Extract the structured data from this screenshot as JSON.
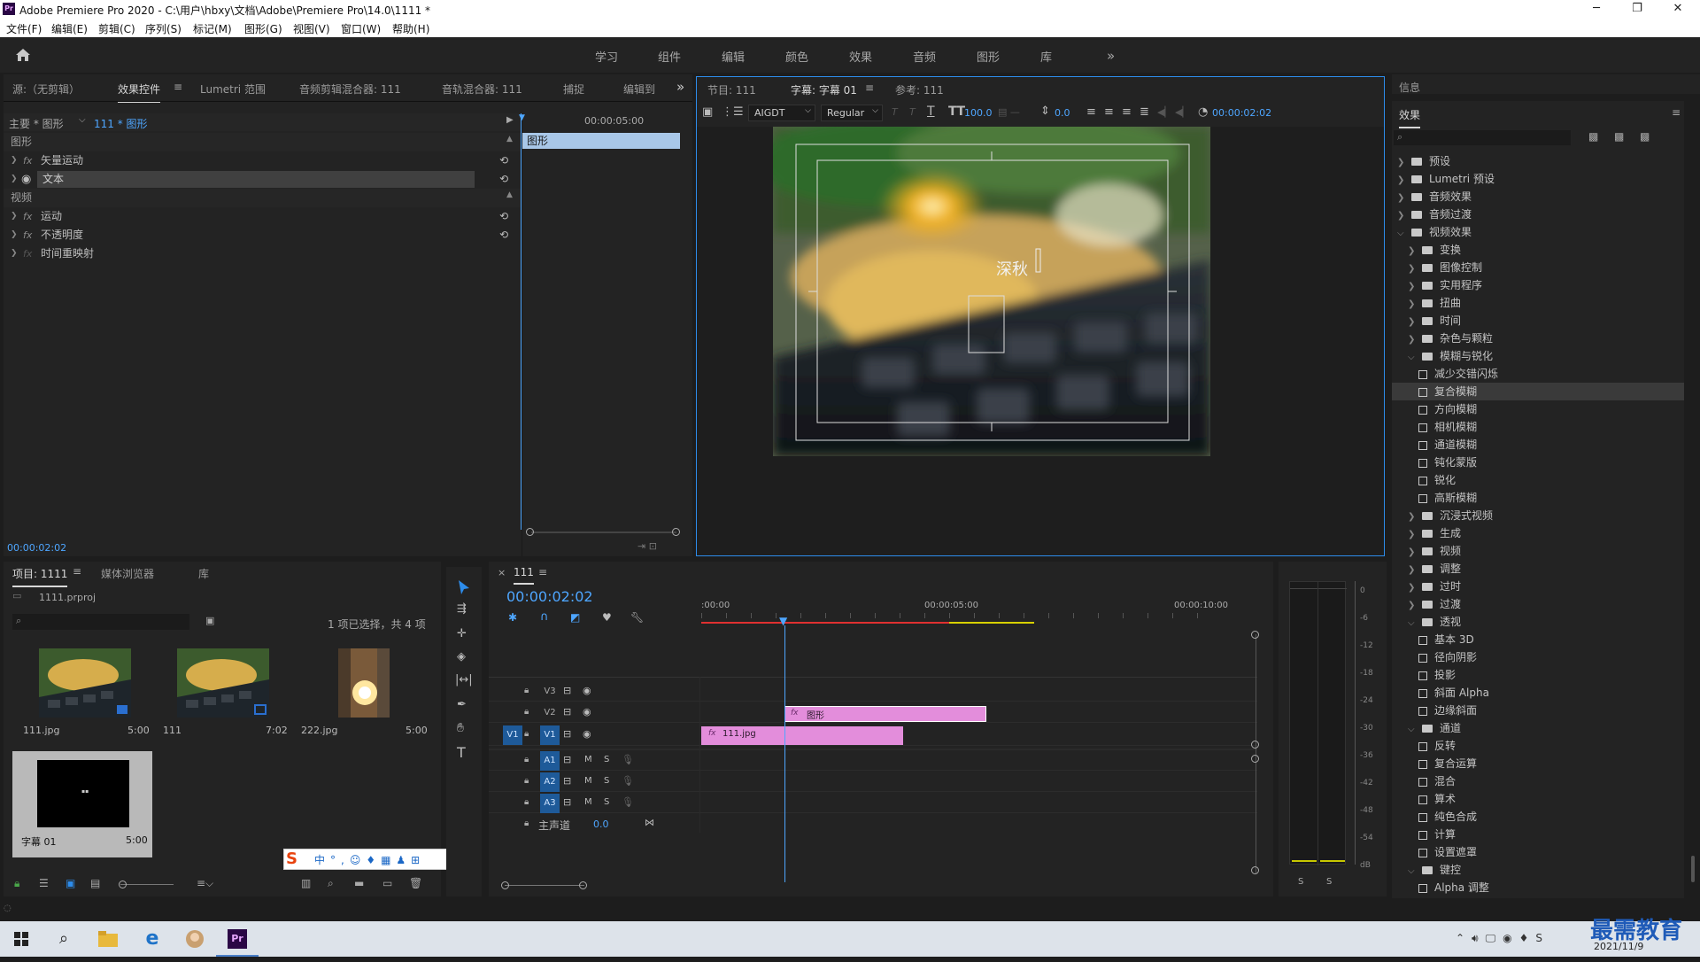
{
  "window": {
    "title": "Adobe Premiere Pro 2020 - C:\\用户\\hbxy\\文档\\Adobe\\Premiere Pro\\14.0\\1111 *",
    "app_icon": "Pr",
    "min": "─",
    "max": "❐",
    "close": "✕"
  },
  "menu": [
    "文件(F)",
    "编辑(E)",
    "剪辑(C)",
    "序列(S)",
    "标记(M)",
    "图形(G)",
    "视图(V)",
    "窗口(W)",
    "帮助(H)"
  ],
  "workspaces": [
    "学习",
    "组件",
    "编辑",
    "颜色",
    "效果",
    "音频",
    "图形",
    "库"
  ],
  "workspace_more": "»",
  "effect_controls": {
    "tabs": [
      "源:（无剪辑）",
      "效果控件",
      "Lumetri 范围",
      "音频剪辑混合器: 111",
      "音轨混合器: 111",
      "捕捉",
      "编辑到"
    ],
    "more": "»",
    "master": "主要 * 图形",
    "clip": "111 * 图形",
    "timecode_ruler": "00:00:05:00",
    "clip_bar": "图形",
    "sec_graphic": "图形",
    "vector_motion": "矢量运动",
    "text": "文本",
    "sec_video": "视频",
    "motion": "运动",
    "opacity": "不透明度",
    "time_remap": "时间重映射",
    "fx": "fx",
    "timecode": "00:00:02:02"
  },
  "program": {
    "tabs": [
      "节目: 111",
      "字幕: 字幕 01",
      "参考: 111"
    ],
    "font": "AIGDT",
    "style": "Regular",
    "size": "100.0",
    "leading": "0.0",
    "timecode": "00:00:02:02",
    "caption_text": "深秋"
  },
  "info": {
    "tab": "信息"
  },
  "effects": {
    "title": "效果",
    "search_placeholder": "",
    "items": [
      {
        "label": "预设",
        "type": "folder",
        "level": 0,
        "open": false
      },
      {
        "label": "Lumetri 预设",
        "type": "folder",
        "level": 0,
        "open": false
      },
      {
        "label": "音频效果",
        "type": "folder",
        "level": 0,
        "open": false
      },
      {
        "label": "音频过渡",
        "type": "folder",
        "level": 0,
        "open": false
      },
      {
        "label": "视频效果",
        "type": "folder",
        "level": 0,
        "open": true
      },
      {
        "label": "变换",
        "type": "folder",
        "level": 1,
        "open": false
      },
      {
        "label": "图像控制",
        "type": "folder",
        "level": 1,
        "open": false
      },
      {
        "label": "实用程序",
        "type": "folder",
        "level": 1,
        "open": false
      },
      {
        "label": "扭曲",
        "type": "folder",
        "level": 1,
        "open": false
      },
      {
        "label": "时间",
        "type": "folder",
        "level": 1,
        "open": false
      },
      {
        "label": "杂色与颗粒",
        "type": "folder",
        "level": 1,
        "open": false
      },
      {
        "label": "模糊与锐化",
        "type": "folder",
        "level": 1,
        "open": true
      },
      {
        "label": "减少交错闪烁",
        "type": "effect",
        "level": 2
      },
      {
        "label": "复合模糊",
        "type": "effect",
        "level": 2,
        "selected": true
      },
      {
        "label": "方向模糊",
        "type": "effect",
        "level": 2
      },
      {
        "label": "相机模糊",
        "type": "effect",
        "level": 2
      },
      {
        "label": "通道模糊",
        "type": "effect",
        "level": 2
      },
      {
        "label": "钝化蒙版",
        "type": "effect",
        "level": 2
      },
      {
        "label": "锐化",
        "type": "effect",
        "level": 2
      },
      {
        "label": "高斯模糊",
        "type": "effect",
        "level": 2
      },
      {
        "label": "沉浸式视频",
        "type": "folder",
        "level": 1,
        "open": false
      },
      {
        "label": "生成",
        "type": "folder",
        "level": 1,
        "open": false
      },
      {
        "label": "视频",
        "type": "folder",
        "level": 1,
        "open": false
      },
      {
        "label": "调整",
        "type": "folder",
        "level": 1,
        "open": false
      },
      {
        "label": "过时",
        "type": "folder",
        "level": 1,
        "open": false
      },
      {
        "label": "过渡",
        "type": "folder",
        "level": 1,
        "open": false
      },
      {
        "label": "透视",
        "type": "folder",
        "level": 1,
        "open": true
      },
      {
        "label": "基本 3D",
        "type": "effect",
        "level": 2
      },
      {
        "label": "径向阴影",
        "type": "effect",
        "level": 2
      },
      {
        "label": "投影",
        "type": "effect",
        "level": 2
      },
      {
        "label": "斜面 Alpha",
        "type": "effect",
        "level": 2
      },
      {
        "label": "边缘斜面",
        "type": "effect",
        "level": 2
      },
      {
        "label": "通道",
        "type": "folder",
        "level": 1,
        "open": true
      },
      {
        "label": "反转",
        "type": "effect",
        "level": 2
      },
      {
        "label": "复合运算",
        "type": "effect",
        "level": 2
      },
      {
        "label": "混合",
        "type": "effect",
        "level": 2
      },
      {
        "label": "算术",
        "type": "effect",
        "level": 2
      },
      {
        "label": "纯色合成",
        "type": "effect",
        "level": 2
      },
      {
        "label": "计算",
        "type": "effect",
        "level": 2
      },
      {
        "label": "设置遮罩",
        "type": "effect",
        "level": 2
      },
      {
        "label": "键控",
        "type": "folder",
        "level": 1,
        "open": true
      },
      {
        "label": "Alpha 调整",
        "type": "effect",
        "level": 2
      }
    ]
  },
  "project": {
    "tabs": [
      "项目: 1111",
      "媒体浏览器",
      "库"
    ],
    "file": "1111.prproj",
    "selection": "1 项已选择，共 4 项",
    "items": [
      {
        "name": "111.jpg",
        "dur": "5:00"
      },
      {
        "name": "111",
        "dur": "7:02"
      },
      {
        "name": "222.jpg",
        "dur": "5:00"
      },
      {
        "name": "字幕 01",
        "dur": "5:00"
      }
    ]
  },
  "timeline": {
    "tab": "111",
    "close": "×",
    "timecode": "00:00:02:02",
    "ruler": [
      ":00:00",
      "00:00:05:00",
      "00:00:10:00"
    ],
    "video_tracks": [
      {
        "label": "V3",
        "src": ""
      },
      {
        "label": "V2",
        "src": ""
      },
      {
        "label": "V1",
        "src": "V1"
      }
    ],
    "audio_tracks": [
      {
        "label": "A1",
        "src": ""
      },
      {
        "label": "A2",
        "src": ""
      },
      {
        "label": "A3",
        "src": ""
      }
    ],
    "master": "主声道",
    "master_val": "0.0",
    "m": "M",
    "s": "S",
    "clip_v2": "图形",
    "clip_v1": "111.jpg",
    "fx": "fx"
  },
  "meter": {
    "scale": [
      "0",
      "-6",
      "-12",
      "-18",
      "-24",
      "-30",
      "-36",
      "-42",
      "-48",
      "-54",
      "dB"
    ],
    "solo": [
      "S",
      "S"
    ]
  },
  "taskbar": {
    "clock": "2021/11/9",
    "watermark": "最需教育"
  },
  "colors": {
    "accent": "#2d8ceb",
    "clip_pink": "#e38ddb",
    "playhead": "#4ea6ff",
    "ruler_red": "#e03030",
    "ruler_yellow": "#d8d000"
  }
}
